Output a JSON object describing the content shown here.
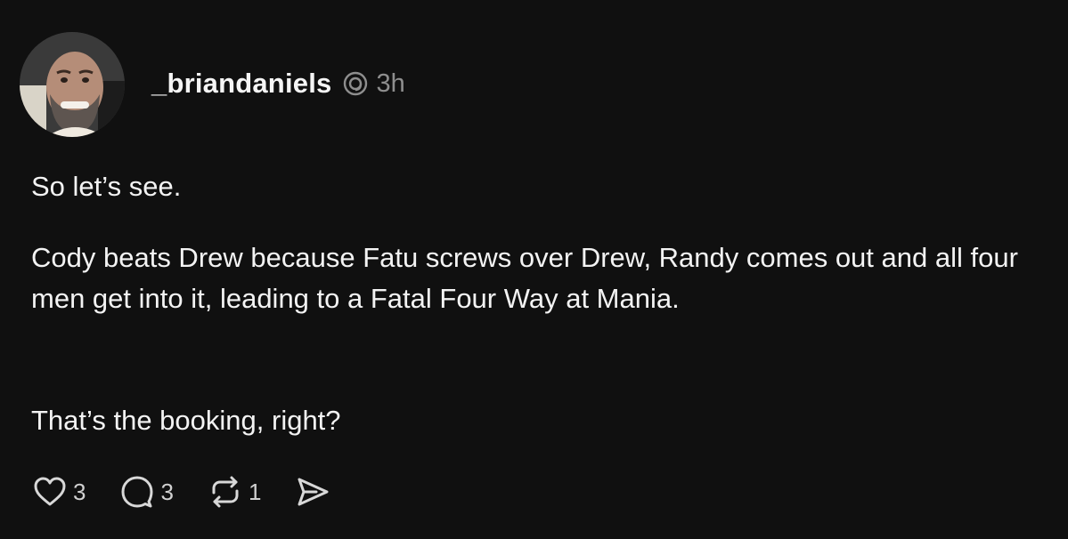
{
  "post": {
    "author": {
      "username": "_briandaniels",
      "avatar_icon": "avatar-photo",
      "badge_icon": "threads-icon"
    },
    "time": "3h",
    "paragraphs": [
      "So let’s see.",
      "Cody beats Drew because Fatu screws over Drew, Randy comes out and all four men get into it, leading to a Fatal Four Way at Mania.",
      "That’s the booking, right?"
    ],
    "actions": {
      "likes": "3",
      "replies": "3",
      "reposts": "1",
      "share_icon": "send-icon"
    }
  },
  "colors": {
    "background": "#101010",
    "text": "#f3f3f3",
    "muted": "#8e8e8e"
  }
}
